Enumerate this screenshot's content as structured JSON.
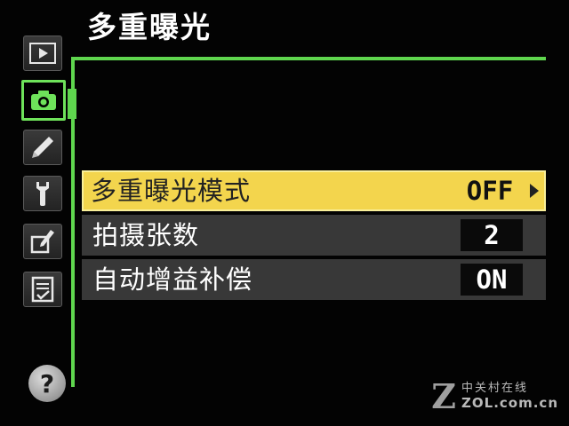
{
  "menu_title": "多重曝光",
  "tabs": [
    {
      "name": "playback-menu",
      "icon": "play-icon"
    },
    {
      "name": "shooting-menu",
      "icon": "camera-icon",
      "active": true
    },
    {
      "name": "custom-settings",
      "icon": "pencil-icon"
    },
    {
      "name": "setup-menu",
      "icon": "wrench-icon"
    },
    {
      "name": "retouch-menu",
      "icon": "retouch-icon"
    },
    {
      "name": "my-menu",
      "icon": "recent-settings-icon"
    }
  ],
  "help_icon": "?",
  "items": [
    {
      "label": "多重曝光模式",
      "value": "OFF",
      "selected": true
    },
    {
      "label": "拍摄张数",
      "value": "2"
    },
    {
      "label": "自动增益补偿",
      "value": "ON"
    }
  ],
  "watermark": {
    "logo": "Z",
    "cn": "中关村在线",
    "en": "ZOL.com.cn"
  },
  "colors": {
    "accent_green": "#5fd64e",
    "highlight_yellow": "#f3d54d",
    "row_gray": "#383838"
  }
}
